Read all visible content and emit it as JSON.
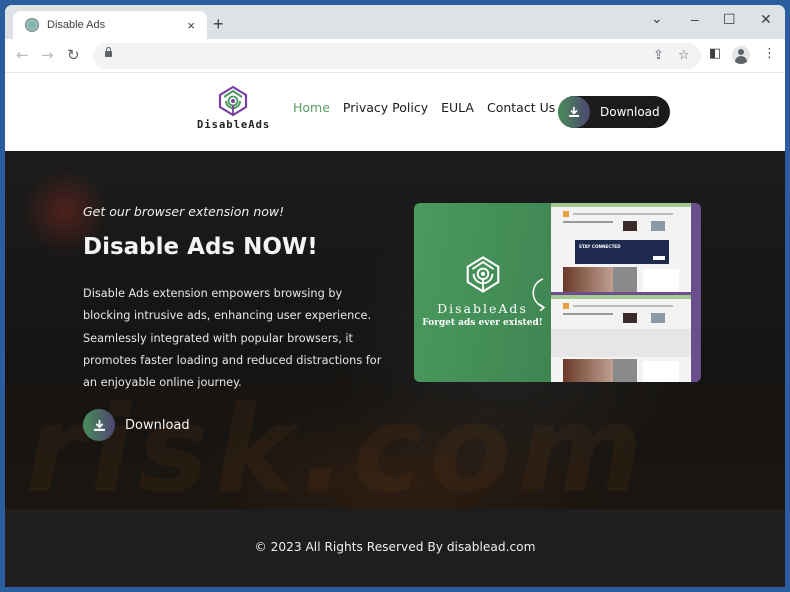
{
  "browser": {
    "tab_title": "Disable Ads",
    "tab_close": "×",
    "new_tab": "+",
    "controls": {
      "tab_search": "⌄",
      "minimize": "–",
      "maximize": "☐",
      "close": "✕"
    },
    "nav": {
      "back": "←",
      "forward": "→",
      "reload": "↻"
    },
    "url": "",
    "icons": {
      "share": "⇪",
      "star": "☆",
      "sidepanel": "◧",
      "menu": "⋮"
    }
  },
  "site": {
    "logo_text": "DisableAds",
    "nav": [
      {
        "label": "Home",
        "active": true
      },
      {
        "label": "Privacy Policy",
        "active": false
      },
      {
        "label": "EULA",
        "active": false
      },
      {
        "label": "Contact Us",
        "active": false
      }
    ],
    "header_download": "Download",
    "hero": {
      "tagline": "Get our browser extension now!",
      "headline": "Disable Ads NOW!",
      "description": "Disable Ads extension empowers browsing by blocking intrusive ads, enhancing user experience. Seamlessly integrated with popular browsers, it promotes faster loading and reduced distractions for an enjoyable online journey.",
      "download_label": "Download",
      "watermark": "risk.com"
    },
    "promo": {
      "brand": "DisableAds",
      "slogan": "Forget ads ever existed!",
      "banner_text": "STAY CONNECTED"
    },
    "footer": "© 2023 All Rights Reserved By disablead.com"
  },
  "colors": {
    "accent_green": "#5d9c63",
    "promo_green": "#4a9a5e",
    "promo_purple": "#6b4f8d",
    "dark": "#1b1b1b"
  }
}
